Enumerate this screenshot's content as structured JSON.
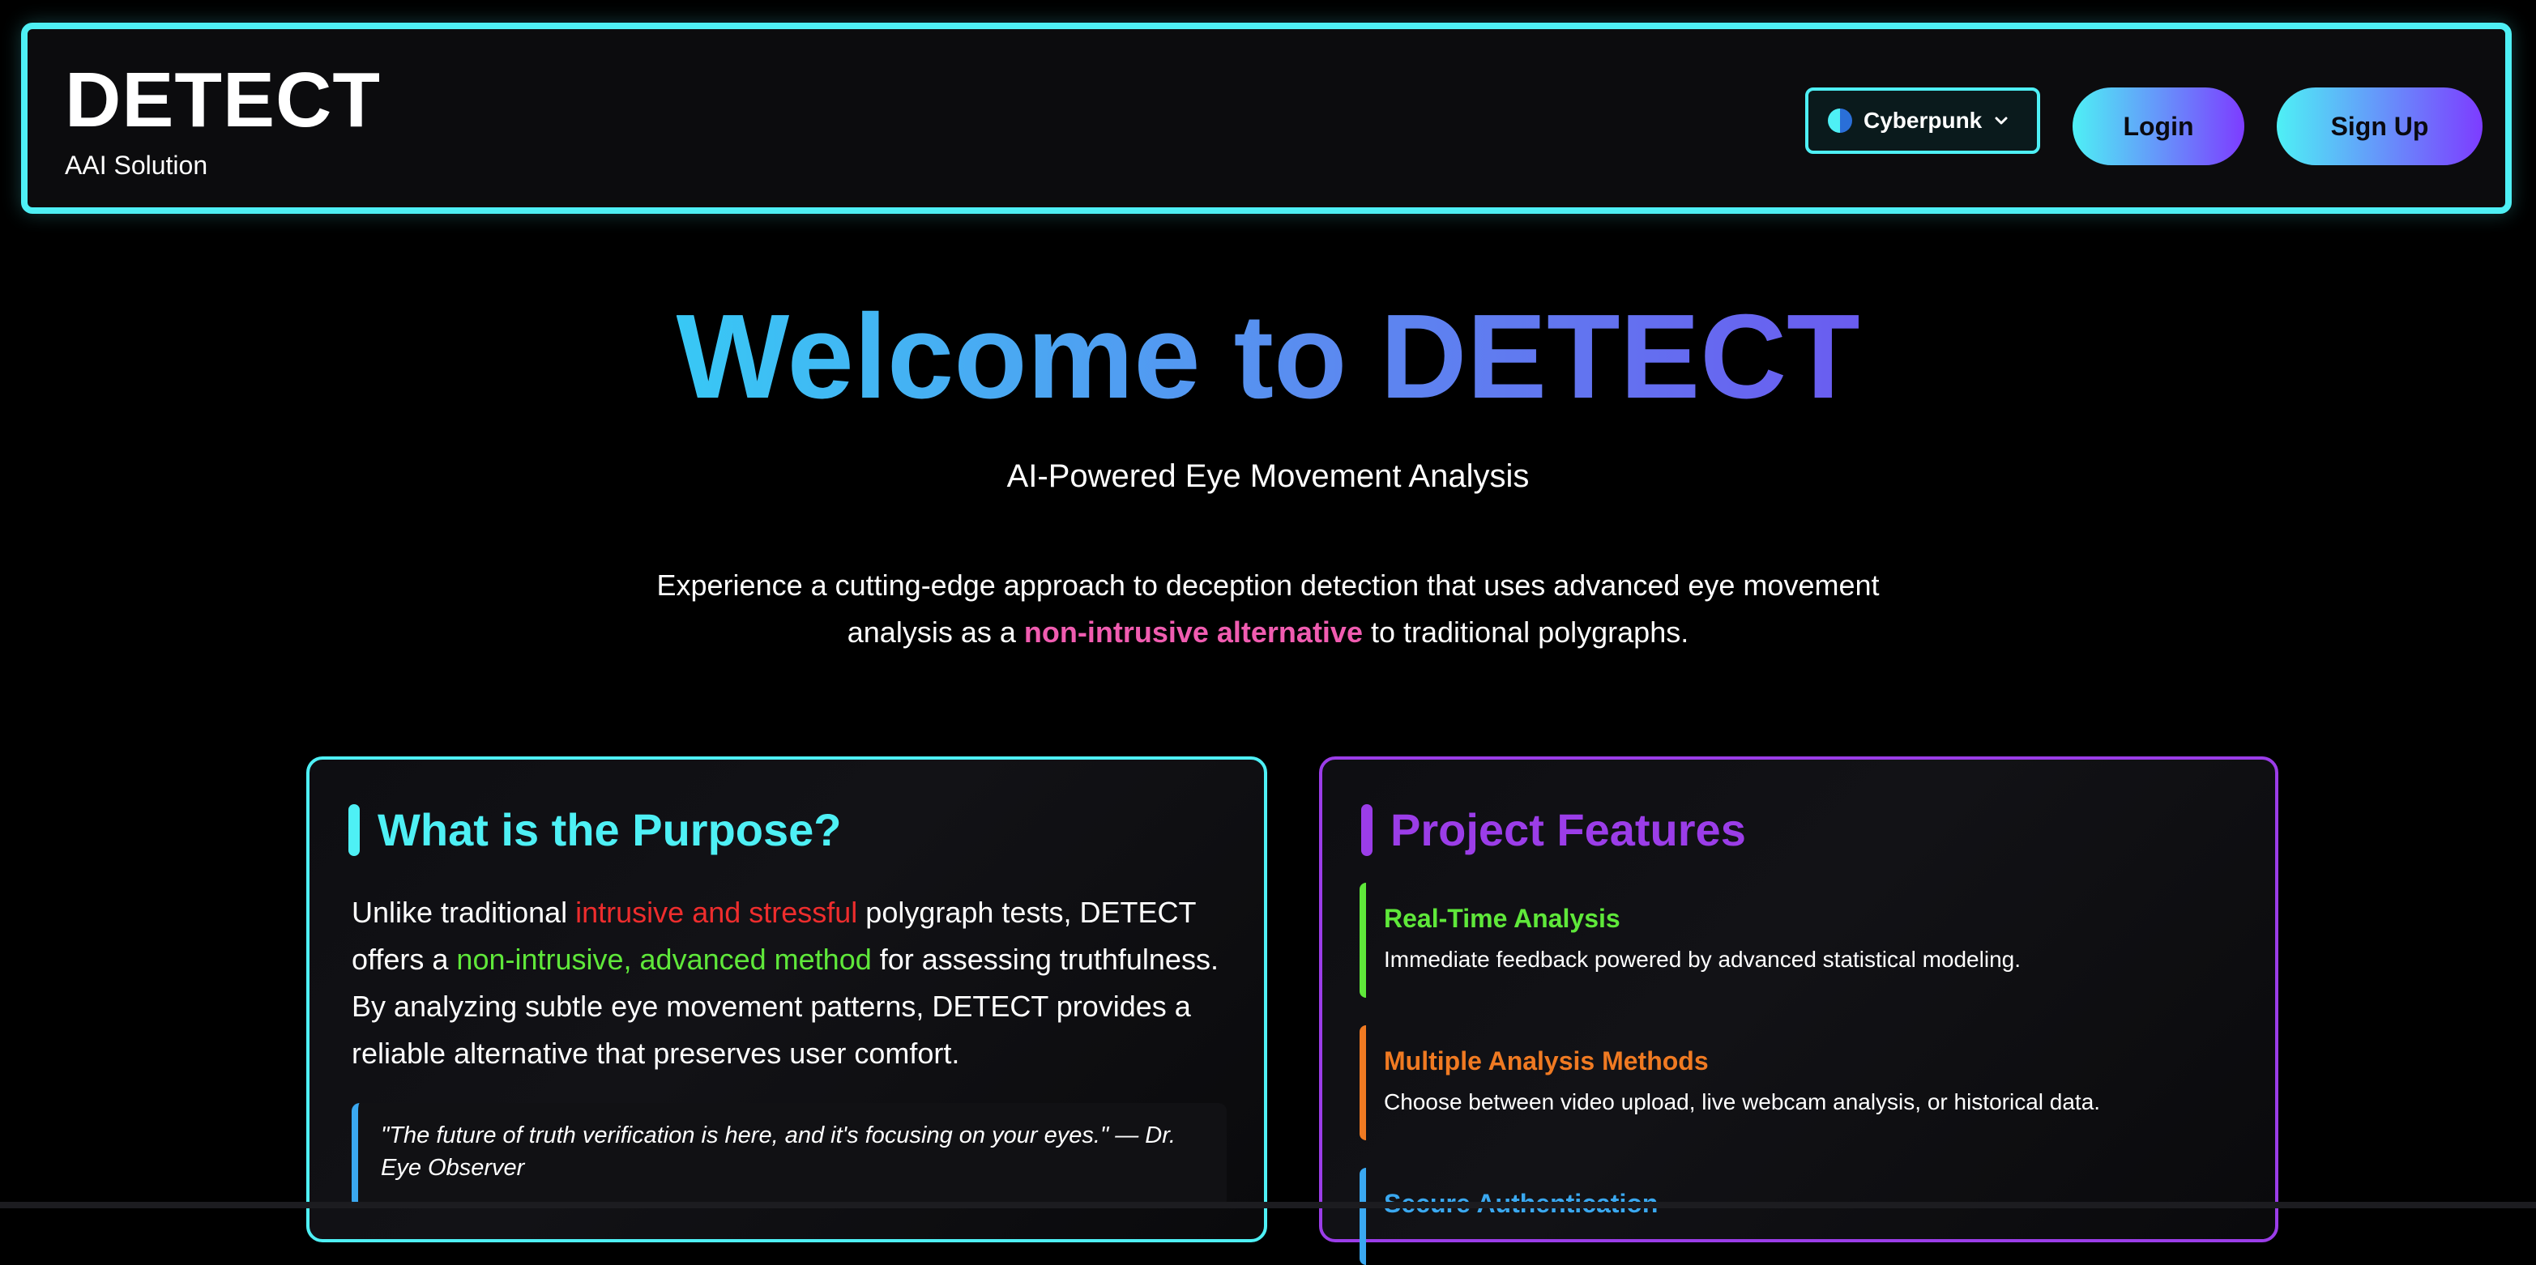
{
  "header": {
    "brand_title": "DETECT",
    "brand_subtitle": "AAI Solution",
    "theme_label": "Cyberpunk",
    "login_label": "Login",
    "signup_label": "Sign Up"
  },
  "hero": {
    "title": "Welcome to DETECT",
    "subtitle": "AI-Powered Eye Movement Analysis",
    "desc_before": "Experience a cutting-edge approach to deception detection that uses advanced eye movement analysis as a ",
    "desc_highlight": "non-intrusive alternative",
    "desc_after": " to traditional polygraphs."
  },
  "purpose": {
    "heading": "What is the Purpose?",
    "t1": "Unlike traditional ",
    "t2": "intrusive and stressful",
    "t3": " polygraph tests, DETECT offers a ",
    "t4": "non-intrusive, advanced method",
    "t5": " for assessing truthfulness. By analyzing subtle eye movement patterns, DETECT provides a reliable alternative that preserves user comfort.",
    "quote": "\"The future of truth verification is here, and it's focusing on your eyes.\" — Dr. Eye Observer"
  },
  "features": {
    "heading": "Project Features",
    "items": [
      {
        "title": "Real-Time Analysis",
        "desc": "Immediate feedback powered by advanced statistical modeling."
      },
      {
        "title": "Multiple Analysis Methods",
        "desc": "Choose between video upload, live webcam analysis, or historical data."
      },
      {
        "title": "Secure Authentication",
        "desc": ""
      }
    ]
  },
  "colors": {
    "accent_cyan": "#4ef0f5",
    "accent_purple": "#9b3de8",
    "highlight_pink": "#f05cb0",
    "highlight_red": "#ee2d2d",
    "highlight_green": "#5fe83a",
    "highlight_orange": "#f07a22",
    "highlight_blue": "#3aa8f0"
  }
}
